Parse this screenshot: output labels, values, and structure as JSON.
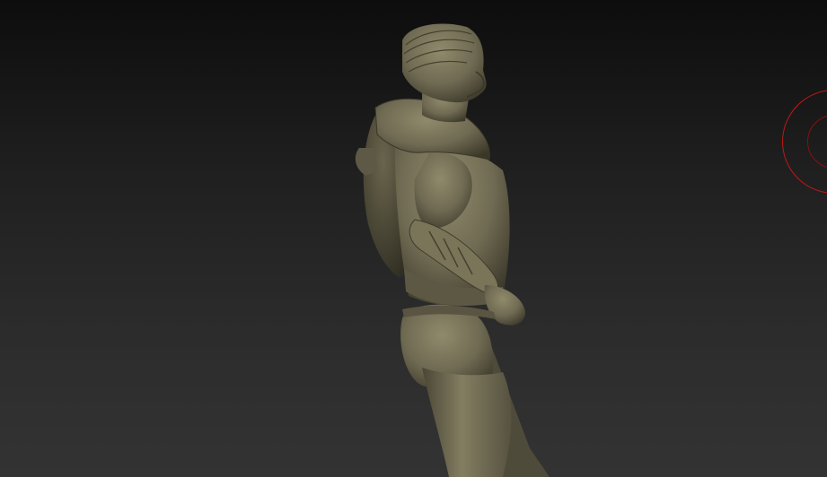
{
  "viewport": {
    "background_top": "#0d0d0d",
    "background_bottom": "#333333"
  },
  "model": {
    "material_color": "#6f6a52",
    "shadow_color": "#3a3729",
    "highlight_color": "#908a6c"
  },
  "brush_cursor": {
    "color": "#c01818"
  }
}
